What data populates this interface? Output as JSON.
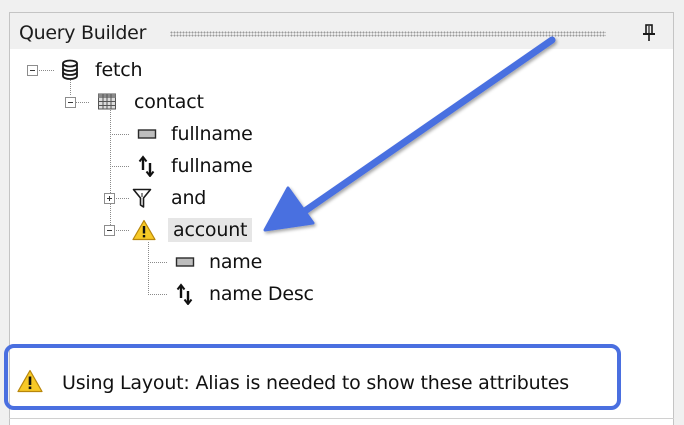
{
  "panel": {
    "title": "Query Builder",
    "pin_icon": "pin-icon"
  },
  "tree": {
    "fetch": {
      "label": "fetch",
      "icon": "database-icon"
    },
    "contact": {
      "label": "contact",
      "icon": "entity-grid-icon"
    },
    "attr_fullname": {
      "label": "fullname",
      "icon": "attribute-icon"
    },
    "order_fullname": {
      "label": "fullname",
      "icon": "sort-order-icon"
    },
    "filter_and": {
      "label": "and",
      "icon": "filter-icon"
    },
    "link_account": {
      "label": "account",
      "icon": "warning-icon",
      "selected": true
    },
    "attr_name": {
      "label": "name",
      "icon": "attribute-icon"
    },
    "order_name": {
      "label": "name Desc",
      "icon": "sort-order-icon"
    }
  },
  "status": {
    "message": "Using Layout: Alias is needed to show these attributes",
    "icon": "warning-icon"
  },
  "colors": {
    "annotation_blue": "#4a6fe0",
    "warning_yellow": "#f7c926",
    "selection_gray": "#e6e6e6"
  }
}
